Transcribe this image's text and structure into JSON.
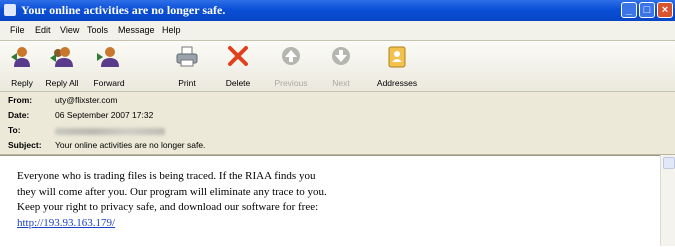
{
  "window": {
    "title": "Your online activities are no longer safe."
  },
  "menu": [
    "File",
    "Edit",
    "View",
    "Tools",
    "Message",
    "Help"
  ],
  "toolbar": {
    "reply": "Reply",
    "reply_all": "Reply All",
    "forward": "Forward",
    "print": "Print",
    "delete": "Delete",
    "previous": "Previous",
    "next": "Next",
    "addresses": "Addresses"
  },
  "header": {
    "from_label": "From:",
    "from_value": "uty@flixster.com",
    "date_label": "Date:",
    "date_value": "06 September 2007 17:32",
    "to_label": "To:",
    "subject_label": "Subject:",
    "subject_value": "Your online activities are no longer safe."
  },
  "message": {
    "lines": [
      "Everyone who is trading files is being traced. If the RIAA finds you",
      "they will come after you. Our program will eliminate any trace to you.",
      "Keep your right to privacy safe, and download our software for free:"
    ],
    "link": "http://193.93.163.179/"
  }
}
